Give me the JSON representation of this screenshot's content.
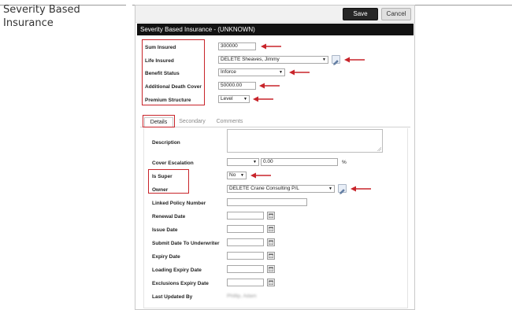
{
  "document": {
    "heading": "Severity Based Insurance"
  },
  "dialog": {
    "title": "Severity Based Insurance - (UNKNOWN)",
    "save_label": "Save",
    "cancel_label": "Cancel"
  },
  "policy": {
    "sum_insured_label": "Sum Insured",
    "sum_insured_value": "300000",
    "life_insured_label": "Life Insured",
    "life_insured_value": "DELETE Sheaves, Jimmy",
    "benefit_status_label": "Benefit Status",
    "benefit_status_value": "Inforce",
    "additional_death_cover_label": "Additional Death Cover",
    "additional_death_cover_value": "50000.00",
    "premium_structure_label": "Premium Structure",
    "premium_structure_value": "Level"
  },
  "tabs": [
    {
      "label": "Details"
    },
    {
      "label": "Secondary"
    },
    {
      "label": "Comments"
    }
  ],
  "details": {
    "description_label": "Description",
    "cover_escalation_label": "Cover Escalation",
    "cover_escalation_value": "",
    "cover_escalation_amount": "0.00",
    "percent_symbol": "%",
    "is_super_label": "Is Super",
    "is_super_value": "No",
    "owner_label": "Owner",
    "owner_value": "DELETE Crane Consulting P/L",
    "linked_policy_number_label": "Linked Policy Number",
    "renewal_date_label": "Renewal Date",
    "issue_date_label": "Issue Date",
    "submit_date_label": "Submit Date To Underwriter",
    "expiry_date_label": "Expiry Date",
    "loading_expiry_date_label": "Loading Expiry Date",
    "exclusions_expiry_date_label": "Exclusions Expiry Date",
    "last_updated_by_label": "Last Updated By",
    "last_updated_by_value": "Phillip, Adam"
  },
  "colors": {
    "highlight": "#c8242a",
    "titlebar": "#121212",
    "save_button": "#262626"
  },
  "icons": {
    "edit": "pencil-icon",
    "calendar": "calendar-icon",
    "dropdown": "chevron-down-icon",
    "annotation": "arrow-left-icon"
  }
}
